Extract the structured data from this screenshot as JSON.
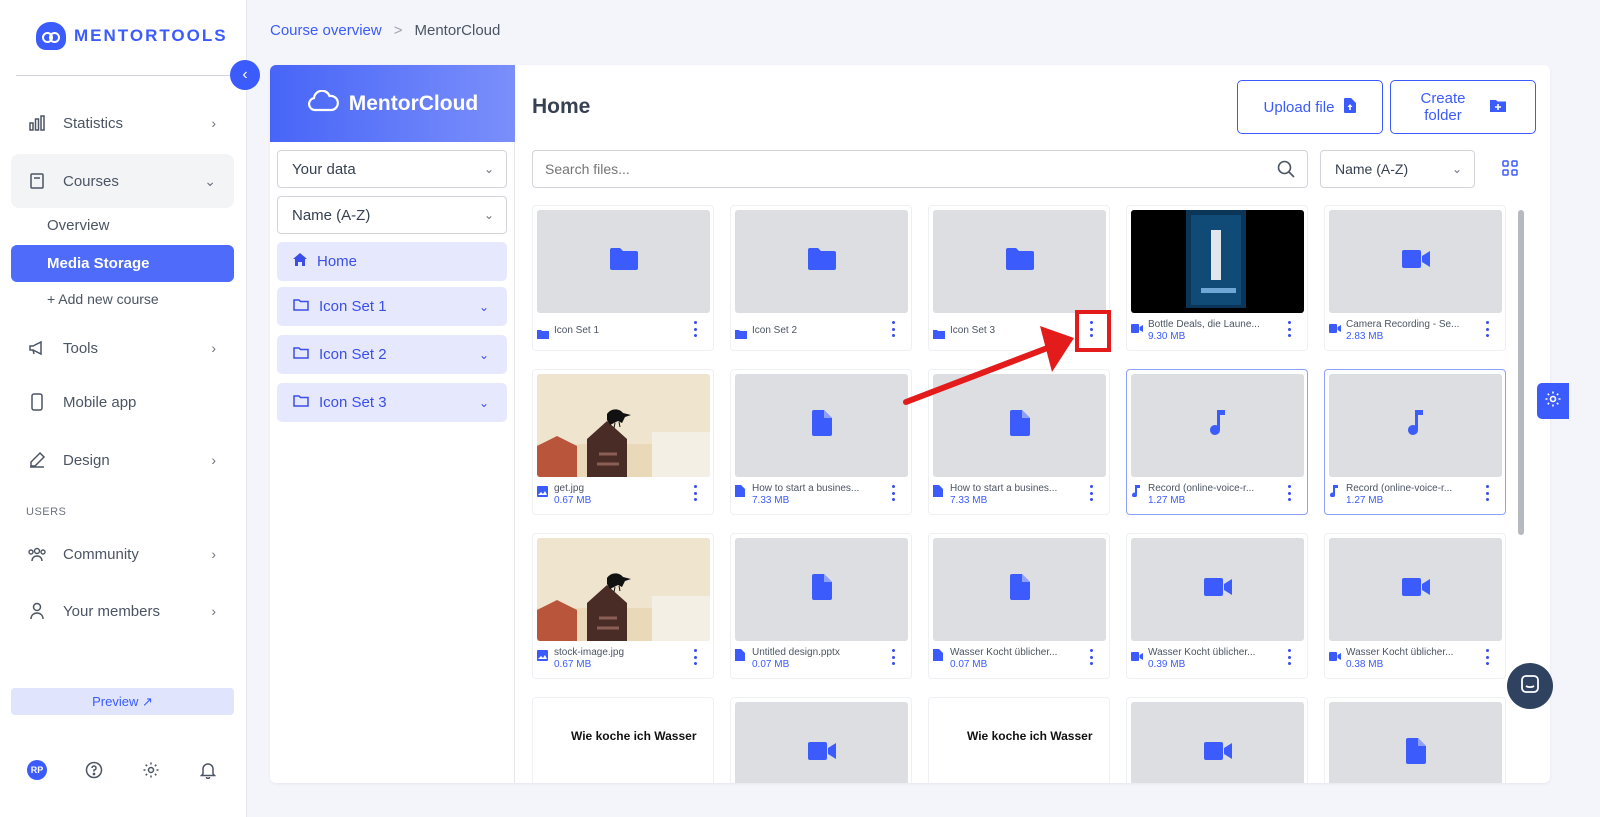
{
  "brand": {
    "name": "MENTORTOOLS"
  },
  "sidebar": {
    "items": [
      {
        "label": "Statistics",
        "icon": "bar-chart-icon"
      },
      {
        "label": "Courses",
        "icon": "book-icon"
      },
      {
        "label": "Tools",
        "icon": "megaphone-icon"
      },
      {
        "label": "Mobile app",
        "icon": "phone-icon"
      },
      {
        "label": "Design",
        "icon": "pen-icon"
      },
      {
        "label": "Community",
        "icon": "people-icon"
      },
      {
        "label": "Your members",
        "icon": "user-icon"
      }
    ],
    "sub": {
      "overview": "Overview",
      "media": "Media Storage",
      "add": "+ Add new course"
    },
    "users_label": "USERS",
    "preview": "Preview ↗",
    "avatar": "RP"
  },
  "breadcrumb": {
    "link": "Course overview",
    "sep": ">",
    "current": "MentorCloud"
  },
  "cloud": {
    "title": "MentorCloud",
    "data_select": "Your data",
    "sort_select": "Name (A-Z)",
    "tree": [
      "Home",
      "Icon Set 1",
      "Icon Set 2",
      "Icon Set 3"
    ]
  },
  "main": {
    "title": "Home",
    "upload": "Upload file",
    "create": "Create\nfolder",
    "search_placeholder": "Search files...",
    "sort": "Name (A-Z)"
  },
  "files": [
    {
      "name": "Icon Set 1",
      "size": "",
      "type": "folder"
    },
    {
      "name": "Icon Set 2",
      "size": "",
      "type": "folder"
    },
    {
      "name": "Icon Set 3",
      "size": "",
      "type": "folder"
    },
    {
      "name": "Bottle Deals, die Laune...",
      "size": "9.30 MB",
      "type": "video-photo"
    },
    {
      "name": "Camera Recording - Se...",
      "size": "2.83 MB",
      "type": "video"
    },
    {
      "name": "get.jpg",
      "size": "0.67 MB",
      "type": "image"
    },
    {
      "name": "How to start a busines...",
      "size": "7.33 MB",
      "type": "doc"
    },
    {
      "name": "How to start a busines...",
      "size": "7.33 MB",
      "type": "doc"
    },
    {
      "name": "Record (online-voice-r...",
      "size": "1.27 MB",
      "type": "audio"
    },
    {
      "name": "Record (online-voice-r...",
      "size": "1.27 MB",
      "type": "audio"
    },
    {
      "name": "stock-image.jpg",
      "size": "0.67 MB",
      "type": "image"
    },
    {
      "name": "Untitled design.pptx",
      "size": "0.07 MB",
      "type": "doc"
    },
    {
      "name": "Wasser Kocht üblicher...",
      "size": "0.07 MB",
      "type": "doc"
    },
    {
      "name": "Wasser Kocht üblicher...",
      "size": "0.39 MB",
      "type": "video"
    },
    {
      "name": "Wasser Kocht üblicher...",
      "size": "0.38 MB",
      "type": "video"
    },
    {
      "name": "",
      "size": "",
      "type": "text",
      "thumb_text": "Wie koche ich Wasser"
    },
    {
      "name": "",
      "size": "",
      "type": "video"
    },
    {
      "name": "",
      "size": "",
      "type": "text",
      "thumb_text": "Wie koche ich Wasser"
    },
    {
      "name": "",
      "size": "",
      "type": "video"
    },
    {
      "name": "",
      "size": "",
      "type": "doc"
    }
  ],
  "colors": {
    "accent": "#3b5bfd",
    "annotation": "#e31b1b"
  }
}
